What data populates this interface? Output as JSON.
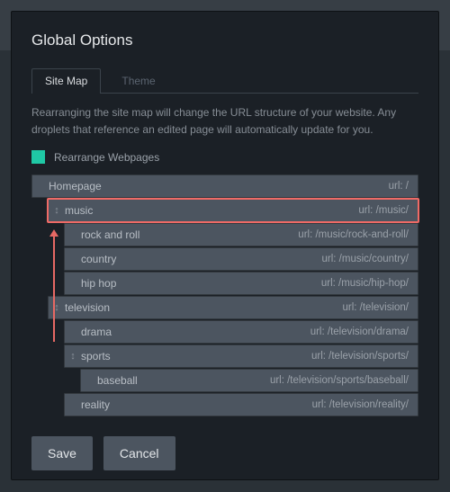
{
  "title": "Global Options",
  "tabs": {
    "sitemap": "Site Map",
    "theme": "Theme"
  },
  "description": "Rearranging the site map will change the URL structure of your website. Any droplets that reference an edited page will automatically update for you.",
  "checkbox_label": "Rearrange Webpages",
  "rows": [
    {
      "indent": 0,
      "handle": false,
      "label": "Homepage",
      "url": "url: /"
    },
    {
      "indent": 1,
      "handle": true,
      "label": "music",
      "url": "url: /music/",
      "highlight": true
    },
    {
      "indent": 2,
      "handle": false,
      "label": "rock and roll",
      "url": "url: /music/rock-and-roll/"
    },
    {
      "indent": 2,
      "handle": false,
      "label": "country",
      "url": "url: /music/country/"
    },
    {
      "indent": 2,
      "handle": false,
      "label": "hip hop",
      "url": "url: /music/hip-hop/"
    },
    {
      "indent": 1,
      "handle": true,
      "label": "television",
      "url": "url: /television/"
    },
    {
      "indent": 2,
      "handle": false,
      "label": "drama",
      "url": "url: /television/drama/"
    },
    {
      "indent": 2,
      "handle": true,
      "label": "sports",
      "url": "url: /television/sports/"
    },
    {
      "indent": 3,
      "handle": false,
      "label": "baseball",
      "url": "url: /television/sports/baseball/"
    },
    {
      "indent": 2,
      "handle": false,
      "label": "reality",
      "url": "url: /television/reality/"
    }
  ],
  "buttons": {
    "save": "Save",
    "cancel": "Cancel"
  }
}
